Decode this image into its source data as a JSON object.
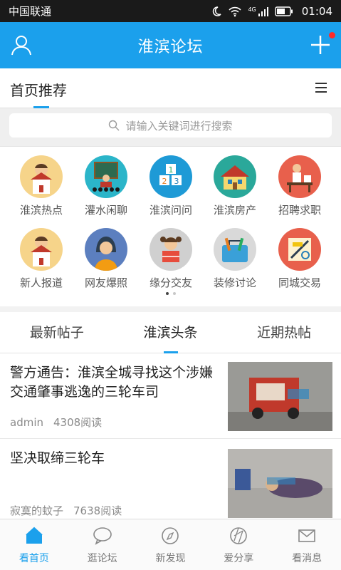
{
  "status_bar": {
    "carrier": "中国联通",
    "network": "4G",
    "time": "01:04"
  },
  "app_bar": {
    "title": "淮滨论坛",
    "user_icon": "user-icon",
    "add_icon": "plus-icon",
    "accent": "#1ba0ec"
  },
  "section": {
    "label": "首页推荐",
    "menu_icon": "menu-icon"
  },
  "search": {
    "placeholder": "请输入关键词进行搜索",
    "icon": "search-icon"
  },
  "categories": [
    {
      "label": "淮滨热点",
      "color": "#f6d48a",
      "icon": "person-house-icon"
    },
    {
      "label": "灌水闲聊",
      "color": "#2bb5c9",
      "icon": "classroom-icon"
    },
    {
      "label": "淮滨问问",
      "color": "#1e9ad6",
      "icon": "number-blocks-icon"
    },
    {
      "label": "淮滨房产",
      "color": "#2aa89a",
      "icon": "house-icon"
    },
    {
      "label": "招聘求职",
      "color": "#e8604c",
      "icon": "desk-worker-icon"
    },
    {
      "label": "新人报道",
      "color": "#f6d48a",
      "icon": "person-house-icon"
    },
    {
      "label": "网友爆照",
      "color": "#5c7fbf",
      "icon": "girl-portrait-icon"
    },
    {
      "label": "缘分交友",
      "color": "#d0d0d0",
      "icon": "girl-reading-icon"
    },
    {
      "label": "装修讨论",
      "color": "#d9d9d9",
      "icon": "toolbag-icon"
    },
    {
      "label": "同城交易",
      "color": "#e8604c",
      "icon": "drawing-tools-icon"
    }
  ],
  "pager": {
    "count": 2,
    "active": 0
  },
  "tabs": [
    {
      "label": "最新帖子",
      "active": false
    },
    {
      "label": "淮滨头条",
      "active": true
    },
    {
      "label": "近期热帖",
      "active": false
    }
  ],
  "posts": [
    {
      "title": "警方通告：淮滨全城寻找这个涉嫌交通肇事逃逸的三轮车司",
      "author": "admin",
      "reads": "4308阅读"
    },
    {
      "title": "坚决取缔三轮车",
      "author": "寂寞的蚊子",
      "reads": "7638阅读"
    }
  ],
  "bottom_nav": [
    {
      "label": "看首页",
      "icon": "home-icon",
      "active": true
    },
    {
      "label": "逛论坛",
      "icon": "chat-icon",
      "active": false
    },
    {
      "label": "新发现",
      "icon": "compass-icon",
      "active": false
    },
    {
      "label": "爱分享",
      "icon": "share-icon",
      "active": false
    },
    {
      "label": "看消息",
      "icon": "mail-icon",
      "active": false
    }
  ]
}
